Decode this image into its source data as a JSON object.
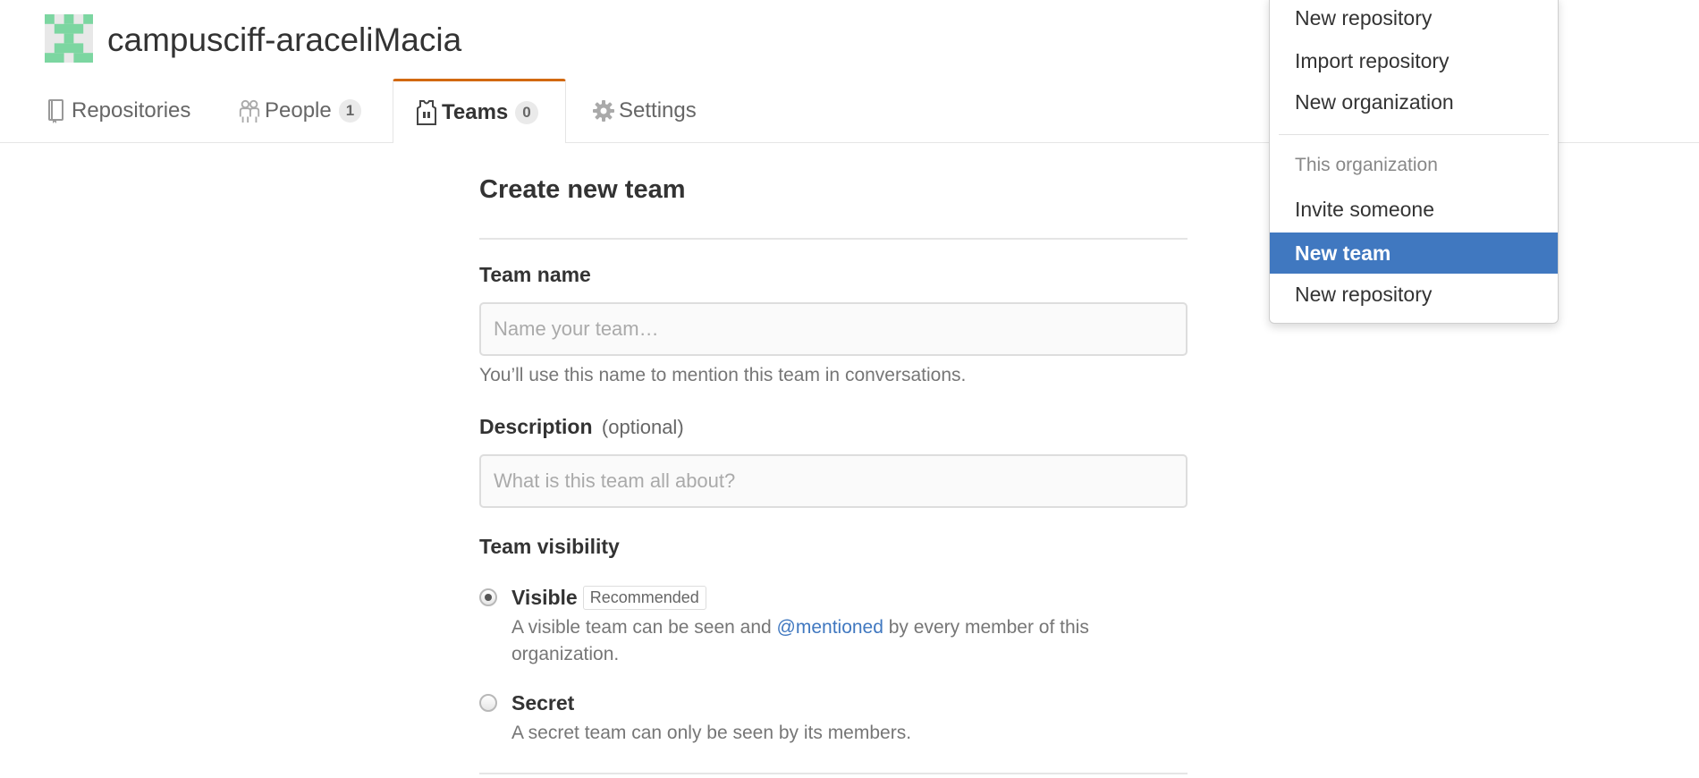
{
  "org": {
    "name": "campusciff-araceliMacia"
  },
  "tabs": {
    "repositories": {
      "label": "Repositories"
    },
    "people": {
      "label": "People",
      "count": "1"
    },
    "teams": {
      "label": "Teams",
      "count": "0"
    },
    "settings": {
      "label": "Settings"
    }
  },
  "form": {
    "title": "Create new team",
    "team_name": {
      "label": "Team name",
      "placeholder": "Name your team…",
      "value": "",
      "hint": "You’ll use this name to mention this team in conversations."
    },
    "description": {
      "label": "Description",
      "optional": "(optional)",
      "placeholder": "What is this team all about?",
      "value": ""
    },
    "visibility": {
      "label": "Team visibility",
      "options": [
        {
          "title": "Visible",
          "badge": "Recommended",
          "desc_before": "A visible team can be seen and ",
          "desc_mention": "@mentioned",
          "desc_after": " by every member of this organization.",
          "selected": true
        },
        {
          "title": "Secret",
          "desc": "A secret team can only be seen by its members.",
          "selected": false
        }
      ]
    }
  },
  "dropdown": {
    "items_top": [
      "New repository",
      "Import repository",
      "New organization"
    ],
    "section_header": "This organization",
    "items_org": [
      "Invite someone",
      "New team",
      "New repository"
    ],
    "active_item": "New team"
  },
  "colors": {
    "tab_accent": "#d26911",
    "dropdown_active": "#4078c0",
    "link": "#4078c0"
  }
}
